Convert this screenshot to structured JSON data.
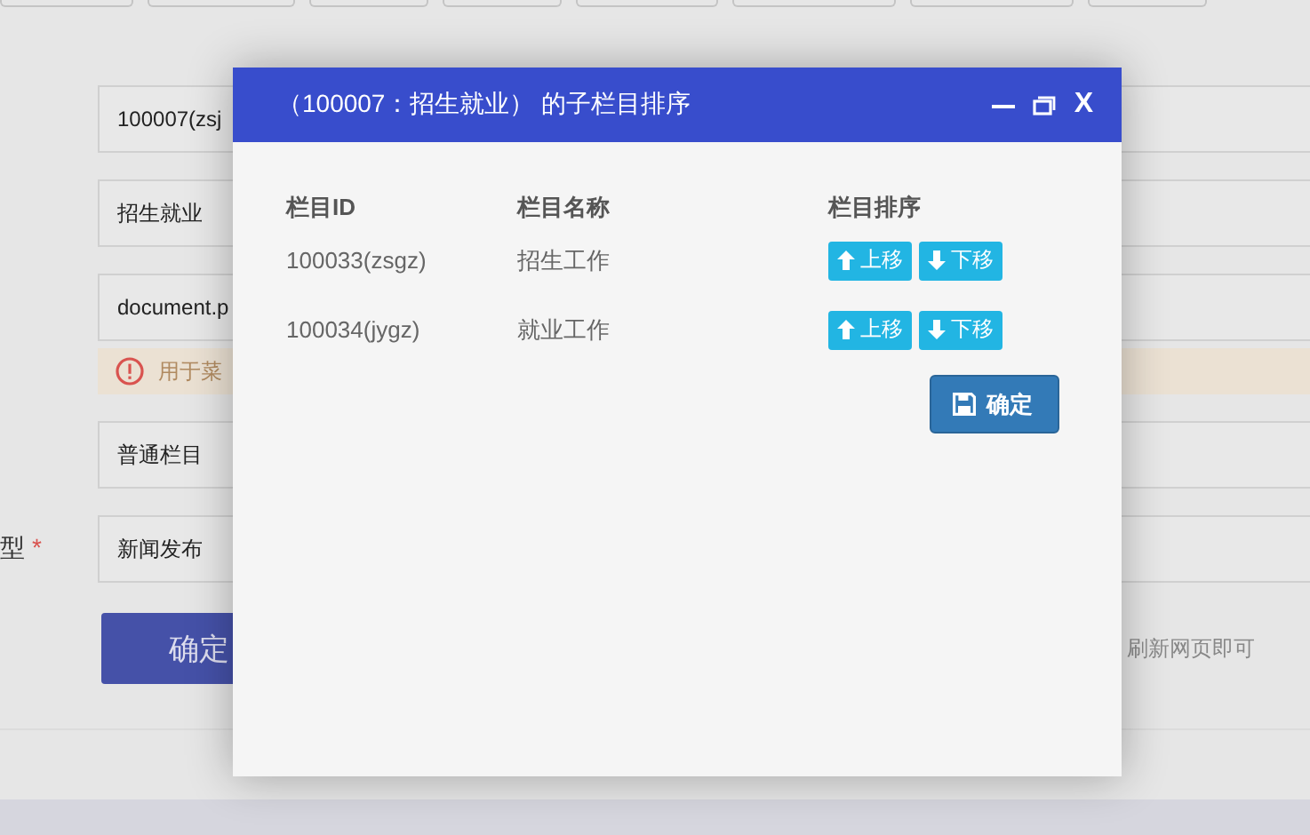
{
  "form": {
    "fields": [
      {
        "kind": "input",
        "value": "100007(zsj"
      },
      {
        "kind": "input",
        "value": "招生就业"
      },
      {
        "kind": "input",
        "value": "document.p",
        "hint": "用于菜"
      },
      {
        "kind": "input",
        "value": "普通栏目"
      },
      {
        "kind": "input",
        "label": "型",
        "required_mark": "*",
        "value": "新闻发布"
      }
    ],
    "submit": "确定",
    "note": "刷新网页即可"
  },
  "dialog": {
    "title": "（100007：招生就业） 的子栏目排序",
    "close": "X",
    "columns": [
      "栏目ID",
      "栏目名称",
      "栏目排序"
    ],
    "rows": [
      {
        "id": "100033(zsgz)",
        "name": "招生工作",
        "up": "上移",
        "down": "下移"
      },
      {
        "id": "100034(jygz)",
        "name": "就业工作",
        "up": "上移",
        "down": "下移"
      }
    ],
    "confirm": "确定"
  }
}
